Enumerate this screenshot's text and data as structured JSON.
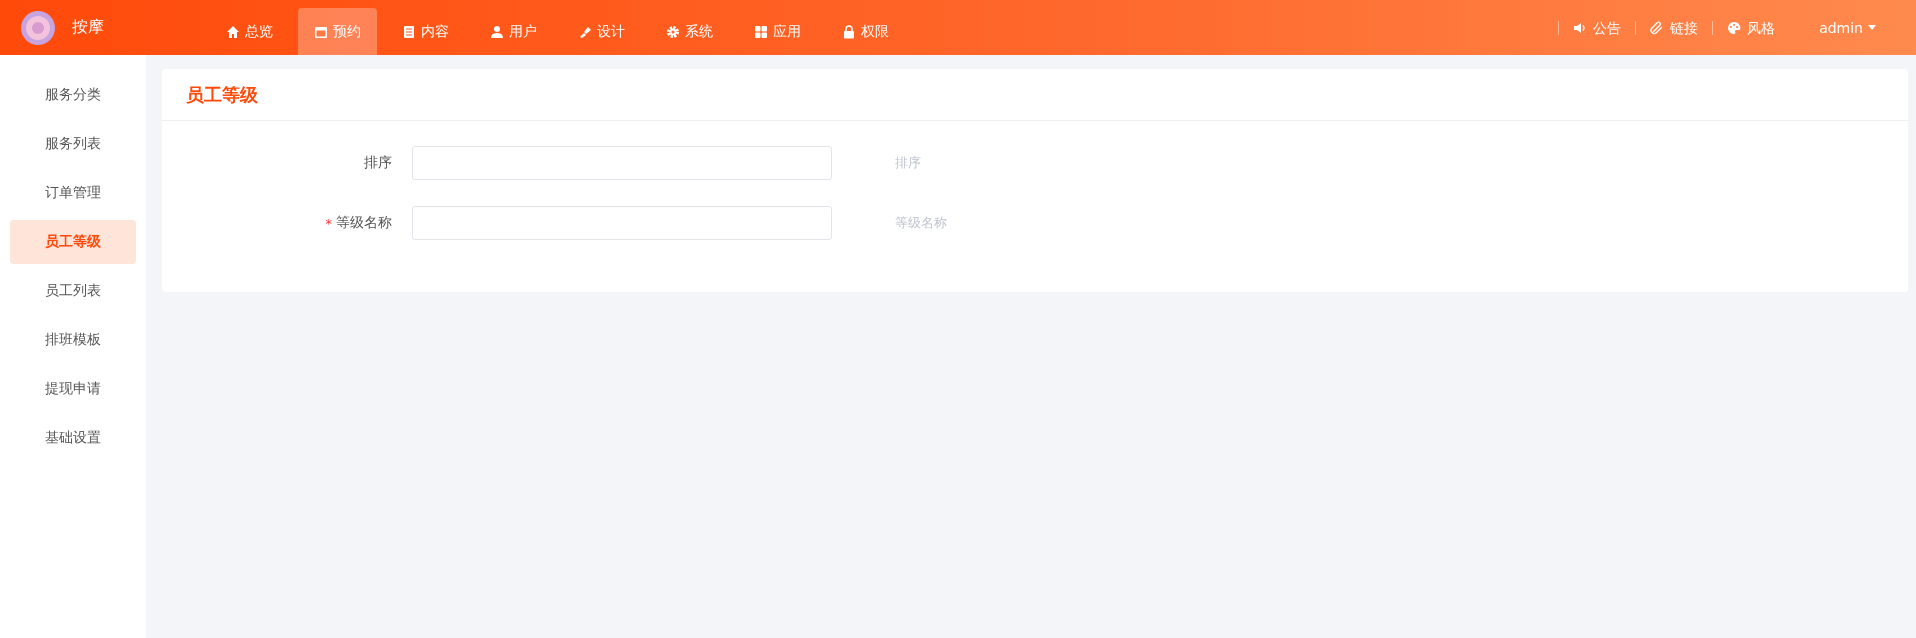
{
  "brand": {
    "name": "按摩"
  },
  "nav": [
    {
      "label": "总览",
      "selected": false
    },
    {
      "label": "预约",
      "selected": true
    },
    {
      "label": "内容",
      "selected": false
    },
    {
      "label": "用户",
      "selected": false
    },
    {
      "label": "设计",
      "selected": false
    },
    {
      "label": "系统",
      "selected": false
    },
    {
      "label": "应用",
      "selected": false
    },
    {
      "label": "权限",
      "selected": false
    }
  ],
  "header_links": [
    {
      "label": "公告"
    },
    {
      "label": "链接"
    },
    {
      "label": "风格"
    }
  ],
  "user_menu": {
    "label": "admin"
  },
  "sidebar": {
    "items": [
      {
        "label": "服务分类",
        "selected": false
      },
      {
        "label": "服务列表",
        "selected": false
      },
      {
        "label": "订单管理",
        "selected": false
      },
      {
        "label": "员工等级",
        "selected": true
      },
      {
        "label": "员工列表",
        "selected": false
      },
      {
        "label": "排班模板",
        "selected": false
      },
      {
        "label": "提现申请",
        "selected": false
      },
      {
        "label": "基础设置",
        "selected": false
      }
    ]
  },
  "card": {
    "title": "员工等级",
    "fields": [
      {
        "label": "排序",
        "hint": "排序"
      },
      {
        "label": "等级名称",
        "required_mark": "*",
        "hint": "等级名称"
      }
    ]
  }
}
